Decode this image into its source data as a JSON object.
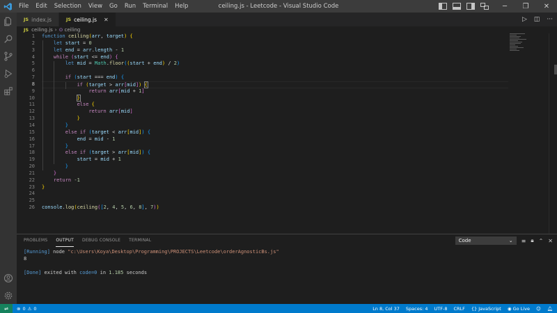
{
  "menu": [
    "File",
    "Edit",
    "Selection",
    "View",
    "Go",
    "Run",
    "Terminal",
    "Help"
  ],
  "window_title": "ceiling.js - Leetcode - Visual Studio Code",
  "tabs": [
    {
      "label": "index.js",
      "badge": "JS"
    },
    {
      "label": "ceiling.js",
      "badge": "JS"
    }
  ],
  "breadcrumb": {
    "file": "ceiling.js",
    "symbol": "ceiling"
  },
  "code": {
    "line_numbers": [
      "1",
      "2",
      "3",
      "4",
      "5",
      "6",
      "7",
      "8",
      "9",
      "10",
      "11",
      "12",
      "13",
      "14",
      "15",
      "16",
      "17",
      "18",
      "19",
      "20",
      "21",
      "22",
      "23",
      "24",
      "25",
      "26"
    ],
    "current_line": 8,
    "tokens": [
      {
        "kw": "function",
        "fn": "ceiling",
        "b1o": "(",
        "a1": "arr",
        "a2": "target",
        "b1c": ")",
        "b2": "{"
      },
      {
        "kw": "let",
        "v": "start",
        "num": "0"
      },
      {
        "kw": "let",
        "v": "end",
        "o": "arr",
        "p": "length",
        "num": "1"
      },
      {
        "kw": "while",
        "v1": "start",
        "v2": "end"
      },
      {
        "kw": "let",
        "v": "mid",
        "obj": "Math",
        "fn": "floor",
        "v1": "start",
        "v2": "end",
        "num": "2"
      },
      {},
      {
        "kw": "if",
        "v": "start",
        "v2": "end"
      },
      {
        "kw": "if",
        "v1": "target",
        "v2": "arr",
        "v3": "mid"
      },
      {
        "kw": "return",
        "v1": "arr",
        "v2": "mid",
        "num": "1"
      },
      {},
      {
        "kw": "else"
      },
      {
        "kw": "return",
        "v1": "arr",
        "v2": "mid"
      },
      {},
      {},
      {
        "kw1": "else",
        "kw2": "if",
        "v1": "target",
        "v2": "arr",
        "v3": "mid"
      },
      {
        "v1": "end",
        "v2": "mid",
        "num": "1"
      },
      {},
      {
        "kw1": "else",
        "kw2": "if",
        "v1": "target",
        "v2": "arr",
        "v3": "mid"
      },
      {
        "v1": "start",
        "v2": "mid",
        "num": "1"
      },
      {},
      {},
      {
        "kw": "return",
        "num": "-1"
      },
      {},
      {},
      {},
      {
        "obj": "console",
        "fn": "log",
        "fn2": "ceiling",
        "nums": [
          "2",
          "4",
          "5",
          "6",
          "8"
        ],
        "num": "7"
      }
    ]
  },
  "panel": {
    "tabs": [
      "PROBLEMS",
      "OUTPUT",
      "DEBUG CONSOLE",
      "TERMINAL"
    ],
    "active_tab": "OUTPUT",
    "select_value": "Code",
    "output": {
      "running_tag": "[Running]",
      "running_cmd": "node",
      "running_path": "\"c:\\Users\\Koya\\Desktop\\Programming\\PROJECTS\\Leetcode\\orderAgnosticBs.js\"",
      "result": "8",
      "done_tag": "[Done]",
      "done_text": "exited with",
      "done_code": "code=0",
      "done_in": "in",
      "done_time": "1.185",
      "done_unit": "seconds"
    }
  },
  "status": {
    "errors": "0",
    "warnings": "0",
    "position": "Ln 8, Col 37",
    "spaces": "Spaces: 4",
    "encoding": "UTF-8",
    "eol": "CRLF",
    "language": "JavaScript",
    "golive": "Go Live"
  }
}
